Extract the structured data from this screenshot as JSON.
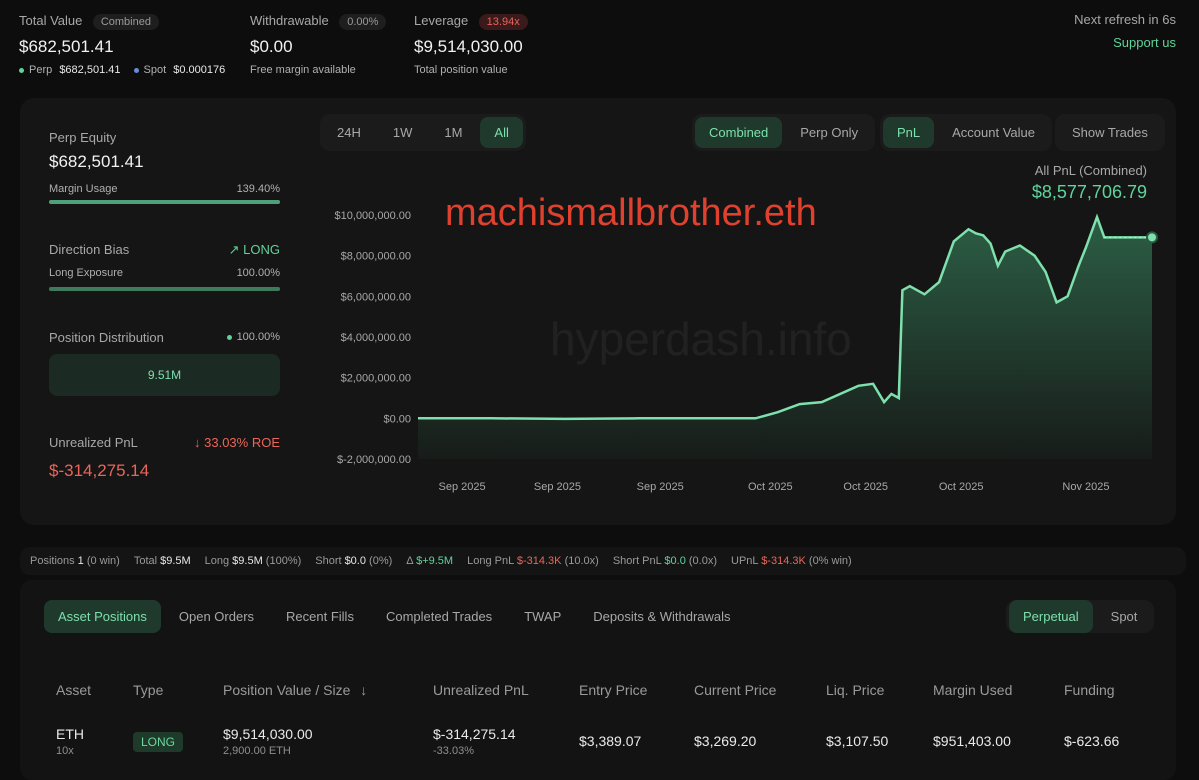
{
  "header": {
    "total_value_label": "Total Value",
    "total_value_badge": "Combined",
    "total_value": "$682,501.41",
    "perp_label": "Perp",
    "perp_value": "$682,501.41",
    "spot_label": "Spot",
    "spot_value": "$0.000176",
    "withdrawable_label": "Withdrawable",
    "withdrawable_badge": "0.00%",
    "withdrawable_value": "$0.00",
    "withdrawable_sub": "Free margin available",
    "leverage_label": "Leverage",
    "leverage_badge": "13.94x",
    "leverage_value": "$9,514,030.00",
    "leverage_sub": "Total position value",
    "refresh_text": "Next refresh in 6s",
    "support_link": "Support us"
  },
  "left_panel": {
    "perp_equity_label": "Perp Equity",
    "perp_equity_value": "$682,501.41",
    "margin_usage_label": "Margin Usage",
    "margin_usage_value": "139.40%",
    "margin_usage_fill": 1.0,
    "direction_bias_label": "Direction Bias",
    "direction_bias_value": "LONG",
    "long_exposure_label": "Long Exposure",
    "long_exposure_value": "100.00%",
    "long_exposure_fill": 1.0,
    "position_dist_label": "Position Distribution",
    "position_dist_value": "100.00%",
    "position_dist_box": "9.51M",
    "unrealized_label": "Unrealized PnL",
    "roe_value": "33.03% ROE",
    "unrealized_value": "$-314,275.14"
  },
  "chart_controls": {
    "range_tabs": [
      "24H",
      "1W",
      "1M",
      "All"
    ],
    "active_range": "All",
    "view_tabs": [
      "Combined",
      "Perp Only"
    ],
    "active_view": "Combined",
    "metric_tabs": [
      "PnL",
      "Account Value"
    ],
    "active_metric": "PnL",
    "show_trades": "Show Trades"
  },
  "chart_overlay": {
    "pnl_title": "All PnL (Combined)",
    "pnl_value": "$8,577,706.79",
    "username": "machismallbrother.eth",
    "watermark": "hyperdash.info"
  },
  "chart_data": {
    "type": "area",
    "ylim": [
      -2000000,
      10000000
    ],
    "yticks": [
      "$10,000,000.00",
      "$8,000,000.00",
      "$6,000,000.00",
      "$4,000,000.00",
      "$2,000,000.00",
      "$0.00",
      "$-2,000,000.00"
    ],
    "ytick_values": [
      10000000,
      8000000,
      6000000,
      4000000,
      2000000,
      0,
      -2000000
    ],
    "xticks": [
      "Sep 2025",
      "Sep 2025",
      "Sep 2025",
      "Oct 2025",
      "Oct 2025",
      "Oct 2025",
      "Nov 2025"
    ],
    "xtick_pos": [
      0.06,
      0.19,
      0.33,
      0.48,
      0.61,
      0.74,
      0.91
    ],
    "series": [
      {
        "x": [
          0.0,
          0.1,
          0.2,
          0.3,
          0.4,
          0.46,
          0.49,
          0.52,
          0.55,
          0.6,
          0.62,
          0.635,
          0.645,
          0.655,
          0.66,
          0.67,
          0.69,
          0.71,
          0.73,
          0.75,
          0.76,
          0.77,
          0.78,
          0.79,
          0.8,
          0.82,
          0.84,
          0.855,
          0.87,
          0.885,
          0.9,
          0.91,
          0.925,
          0.935,
          0.95,
          1.0
        ],
        "values": [
          0,
          0,
          -30000,
          0,
          0,
          0,
          300000,
          700000,
          800000,
          1600000,
          1700000,
          800000,
          1200000,
          1000000,
          6300000,
          6500000,
          6100000,
          6700000,
          8700000,
          9300000,
          9100000,
          9000000,
          8600000,
          7500000,
          8200000,
          8500000,
          8000000,
          7200000,
          5700000,
          6000000,
          7500000,
          8400000,
          9900000,
          8900000,
          8900000,
          8900000
        ]
      }
    ]
  },
  "stats": {
    "positions_label": "Positions",
    "positions_value": "1",
    "positions_win": "(0 win)",
    "total_label": "Total",
    "total_value": "$9.5M",
    "long_label": "Long",
    "long_value": "$9.5M",
    "long_pct": "(100%)",
    "short_label": "Short",
    "short_value": "$0.0",
    "short_pct": "(0%)",
    "delta_label": "Δ",
    "delta_value": "$+9.5M",
    "long_pnl_label": "Long PnL",
    "long_pnl_value": "$-314.3K",
    "long_pnl_x": "(10.0x)",
    "short_pnl_label": "Short PnL",
    "short_pnl_value": "$0.0",
    "short_pnl_x": "(0.0x)",
    "upnl_label": "UPnL",
    "upnl_value": "$-314.3K",
    "upnl_win": "(0% win)"
  },
  "bottom_tabs": {
    "tabs": [
      "Asset Positions",
      "Open Orders",
      "Recent Fills",
      "Completed Trades",
      "TWAP",
      "Deposits & Withdrawals"
    ],
    "active": "Asset Positions",
    "market_tabs": [
      "Perpetual",
      "Spot"
    ],
    "active_market": "Perpetual"
  },
  "table": {
    "headers": [
      "Asset",
      "Type",
      "Position Value / Size",
      "Unrealized PnL",
      "Entry Price",
      "Current Price",
      "Liq. Price",
      "Margin Used",
      "Funding"
    ],
    "sort_icon": "arrow-down-icon",
    "rows": [
      {
        "asset": "ETH",
        "leverage": "10x",
        "type": "LONG",
        "position_value": "$9,514,030.00",
        "size": "2,900.00 ETH",
        "upnl": "$-314,275.14",
        "upnl_pct": "-33.03%",
        "entry": "$3,389.07",
        "current": "$3,269.20",
        "liq": "$3,107.50",
        "margin": "$951,403.00",
        "funding": "$-623.66"
      }
    ]
  },
  "colors": {
    "accent": "#5fd39a",
    "negative": "#e8665a",
    "background": "#0d0d0d"
  }
}
